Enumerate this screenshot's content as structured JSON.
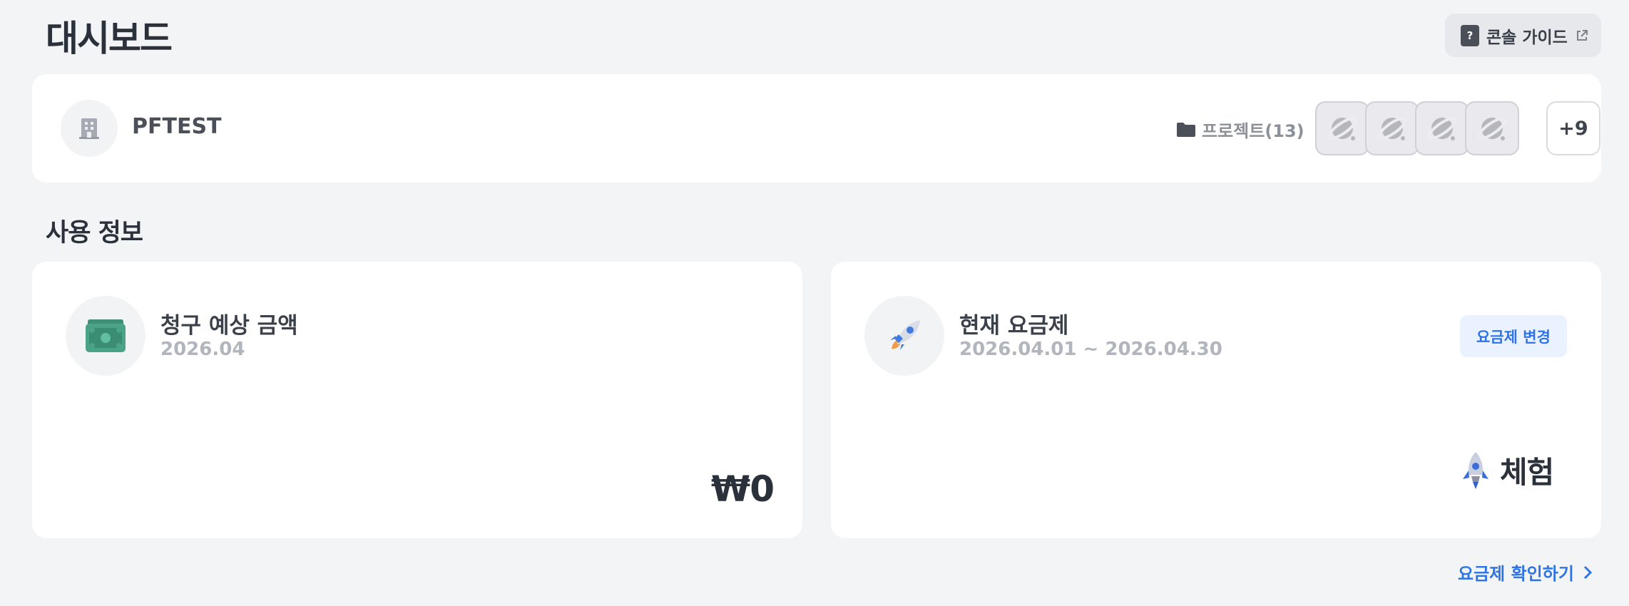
{
  "header": {
    "title": "대시보드",
    "guide_button_label": "콘솔 가이드"
  },
  "organization": {
    "name": "PFTEST",
    "projects_label": "프로젝트(13)",
    "more_projects_label": "+9"
  },
  "usage": {
    "section_title": "사용 정보",
    "billing": {
      "title": "청구 예상 금액",
      "period": "2026.04",
      "amount": "₩0"
    },
    "plan": {
      "title": "현재 요금제",
      "period": "2026.04.01 ~ 2026.04.30",
      "change_button_label": "요금제 변경",
      "plan_name": "체험"
    },
    "view_plans_link": "요금제 확인하기"
  },
  "colors": {
    "accent": "#2e74e6",
    "page_background": "#f3f4f6",
    "card_background": "#ffffff"
  },
  "icons": [
    "help-icon",
    "external-link-icon",
    "building-icon",
    "folder-icon",
    "planet-icon",
    "money-icon",
    "rocket-icon",
    "chevron-right-icon"
  ]
}
